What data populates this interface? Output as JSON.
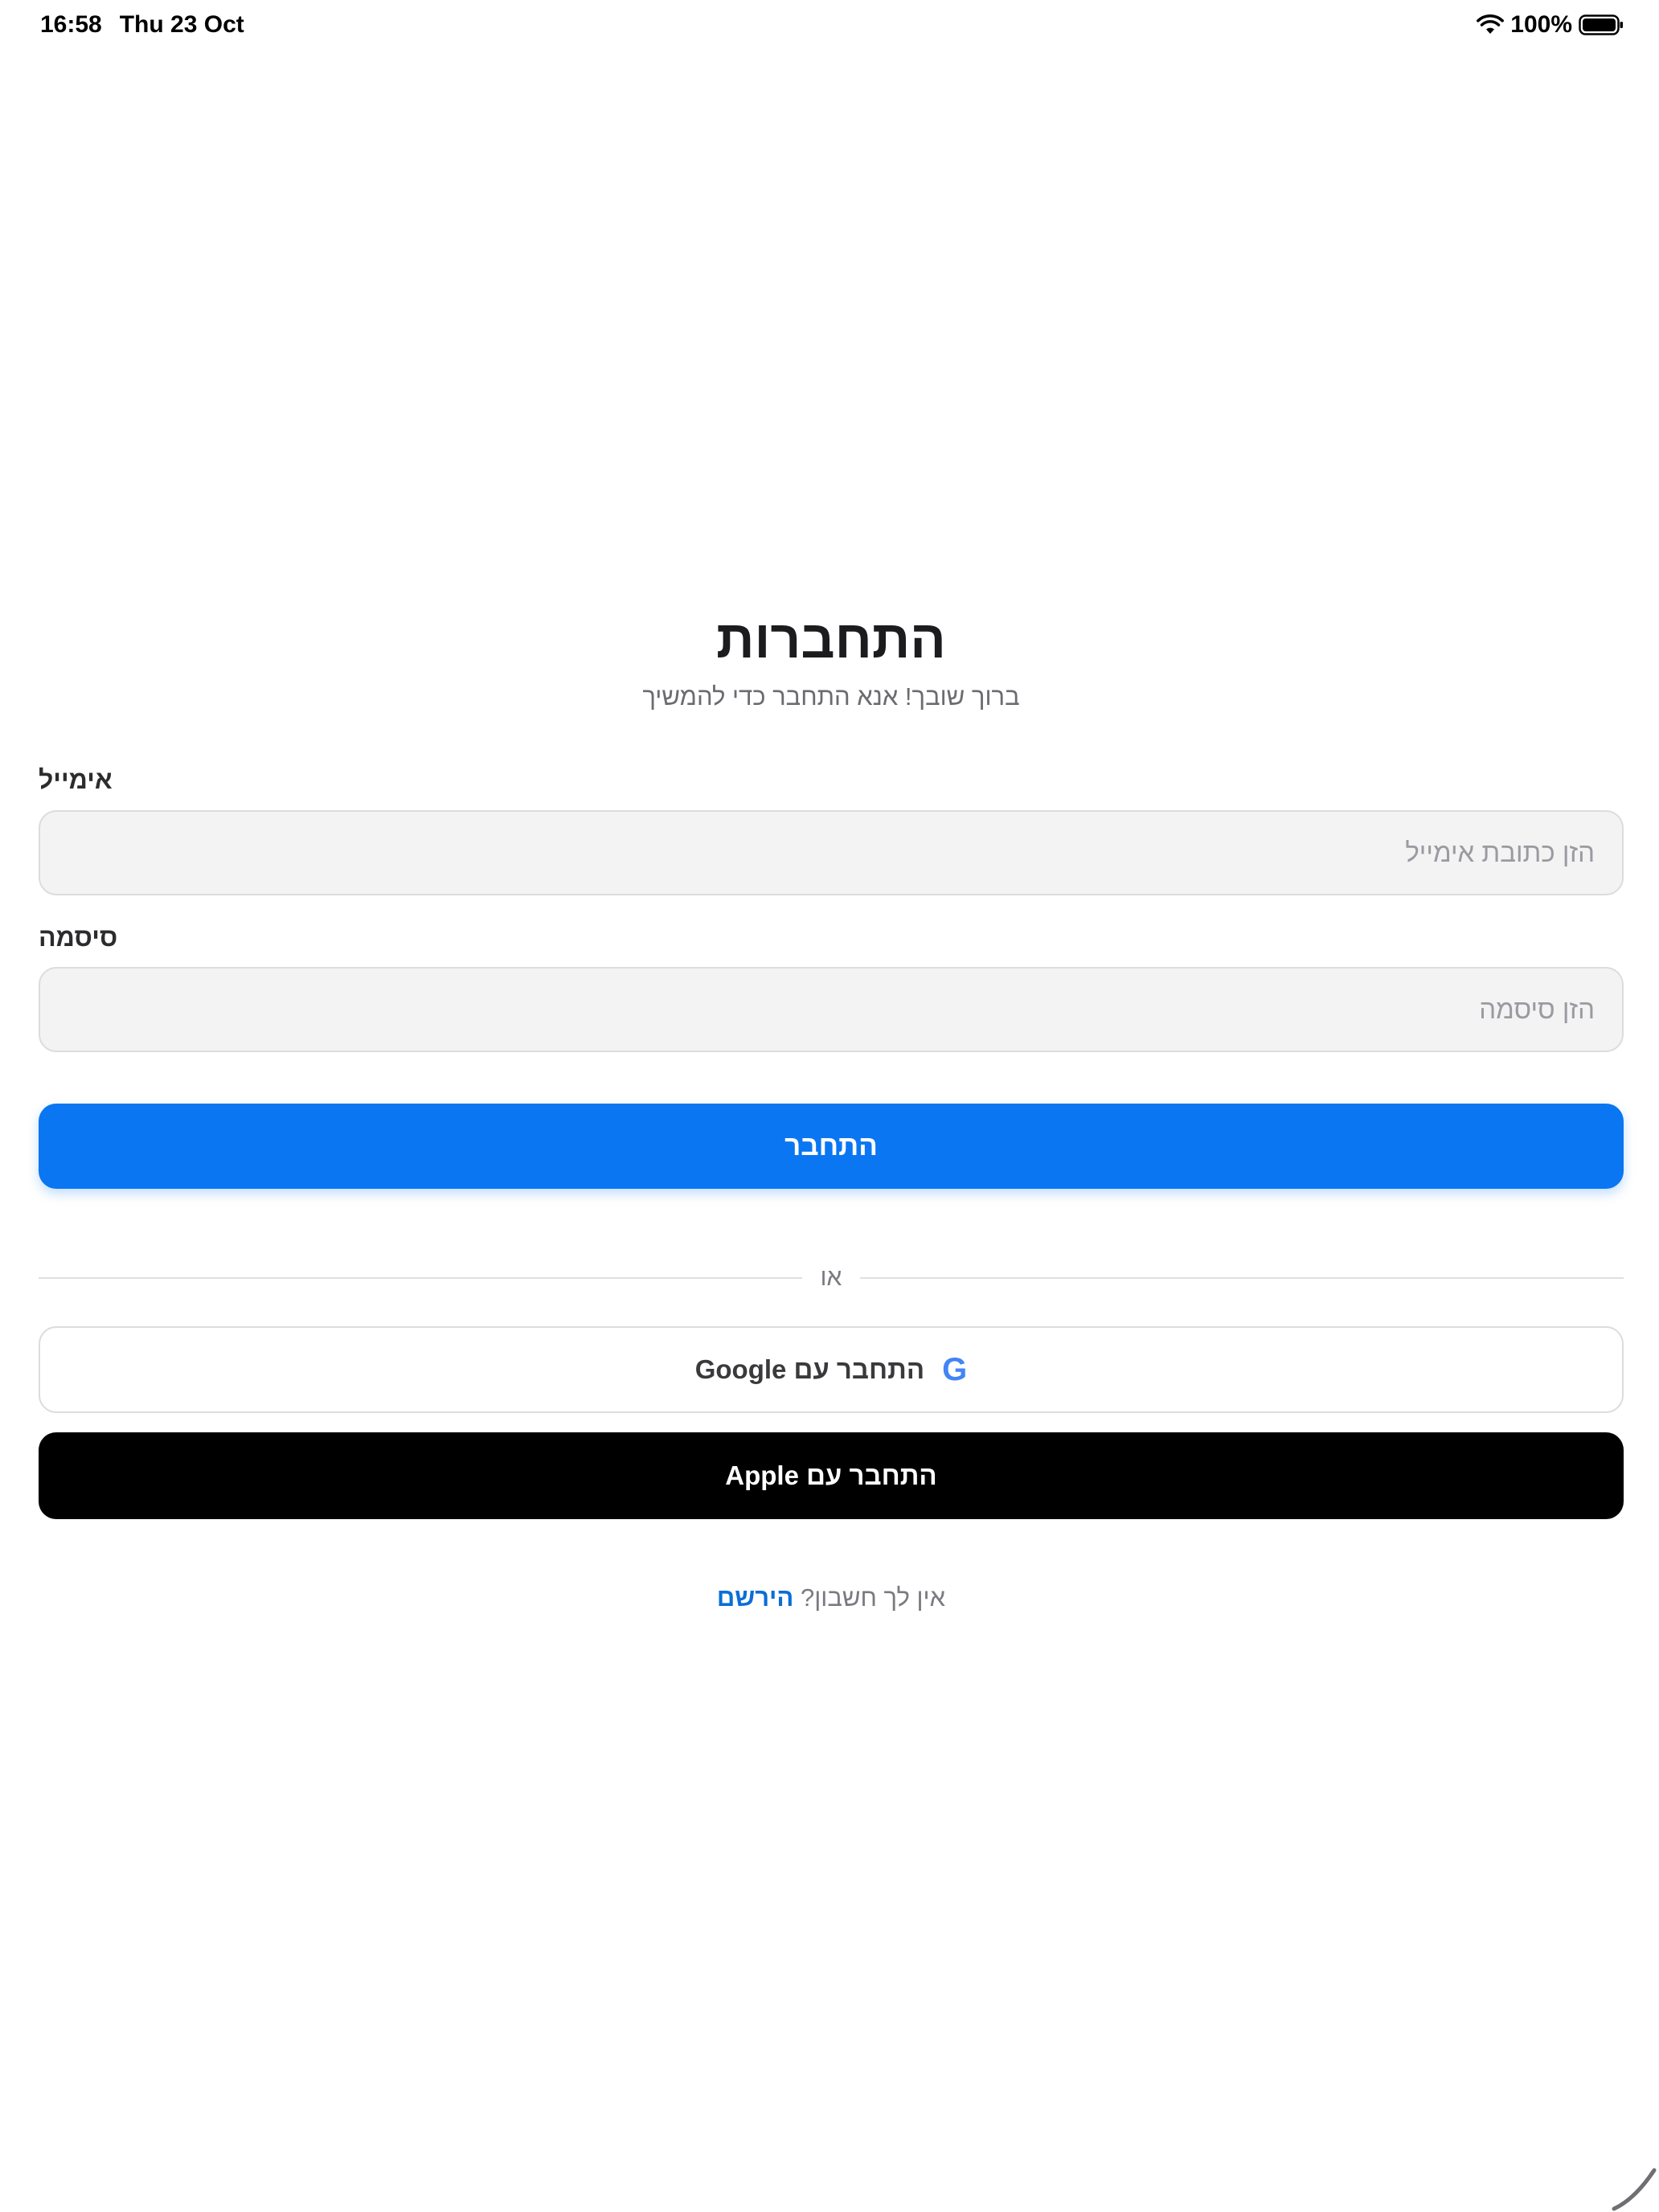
{
  "status_bar": {
    "time": "16:58",
    "date": "Thu 23 Oct",
    "battery": "100%",
    "icons": [
      "wifi-icon",
      "battery-icon"
    ]
  },
  "login": {
    "title": "התחברות",
    "subtitle": "ברוך שובך! אנא התחבר כדי להמשיך",
    "email_label": "אימייל",
    "email_placeholder": "הזן כתובת אימייל",
    "email_value": "",
    "password_label": "סיסמה",
    "password_placeholder": "הזן סיסמה",
    "password_value": "",
    "submit_label": "התחבר",
    "divider_text": "או",
    "google_label": "התחבר עם Google",
    "google_icon_glyph": "G",
    "apple_label": "התחבר עם Apple",
    "signup_prompt": "אין לך חשבון?",
    "signup_link": "הירשם"
  },
  "colors": {
    "primary": "#0a76f2",
    "apple_button": "#000000",
    "google_icon": "#4285f4",
    "link": "#0a6ed6",
    "input_background": "#f3f3f4"
  }
}
